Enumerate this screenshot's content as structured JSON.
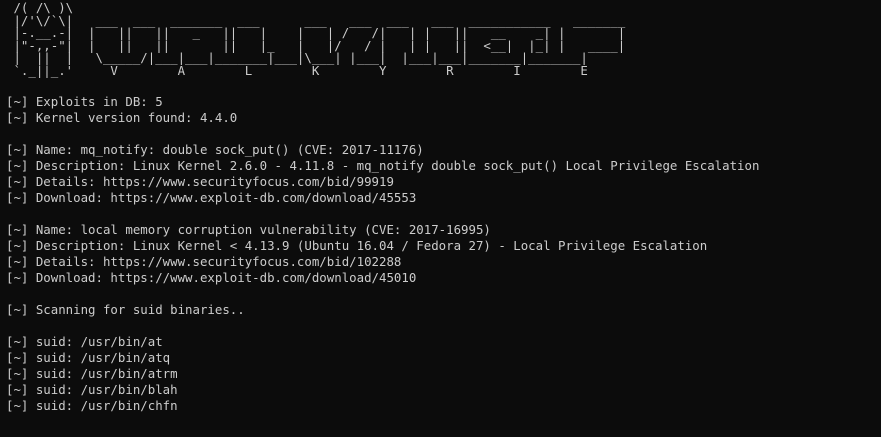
{
  "banner": [
    " /( /\\ )\\",
    " |/'\\/`\\|   ___  ___  _______  ___      ___   ___  ___   ___  ___________   _______",
    " |-.__.-|  |   ||   ||   _   ||   |    |   | /   /|   | |   ||   __    _| |       |",
    " |\"-,,-\"|  |   ||   ||       ||   |_   |   |/   / |   | |   ||  <__|  |_| |   ____|",
    " |  ||  |   \\_____/|___|___|_______|___|\\___| |___|  |___|___|_______|_______|",
    " `._||_.'     V        A        L        K        Y        R        I        E"
  ],
  "lines": [
    "",
    "[~] Exploits in DB: 5",
    "[~] Kernel version found: 4.4.0",
    "",
    "[~] Name: mq_notify: double sock_put() (CVE: 2017-11176)",
    "[~] Description: Linux Kernel 2.6.0 - 4.11.8 - mq_notify double sock_put() Local Privilege Escalation",
    "[~] Details: https://www.securityfocus.com/bid/99919",
    "[~] Download: https://www.exploit-db.com/download/45553",
    "",
    "[~] Name: local memory corruption vulnerability (CVE: 2017-16995)",
    "[~] Description: Linux Kernel < 4.13.9 (Ubuntu 16.04 / Fedora 27) - Local Privilege Escalation",
    "[~] Details: https://www.securityfocus.com/bid/102288",
    "[~] Download: https://www.exploit-db.com/download/45010",
    "",
    "[~] Scanning for suid binaries..",
    "",
    "[~] suid: /usr/bin/at",
    "[~] suid: /usr/bin/atq",
    "[~] suid: /usr/bin/atrm",
    "[~] suid: /usr/bin/blah",
    "[~] suid: /usr/bin/chfn"
  ],
  "colors": {
    "background": "#0c0c0c",
    "foreground": "#cccccc"
  }
}
